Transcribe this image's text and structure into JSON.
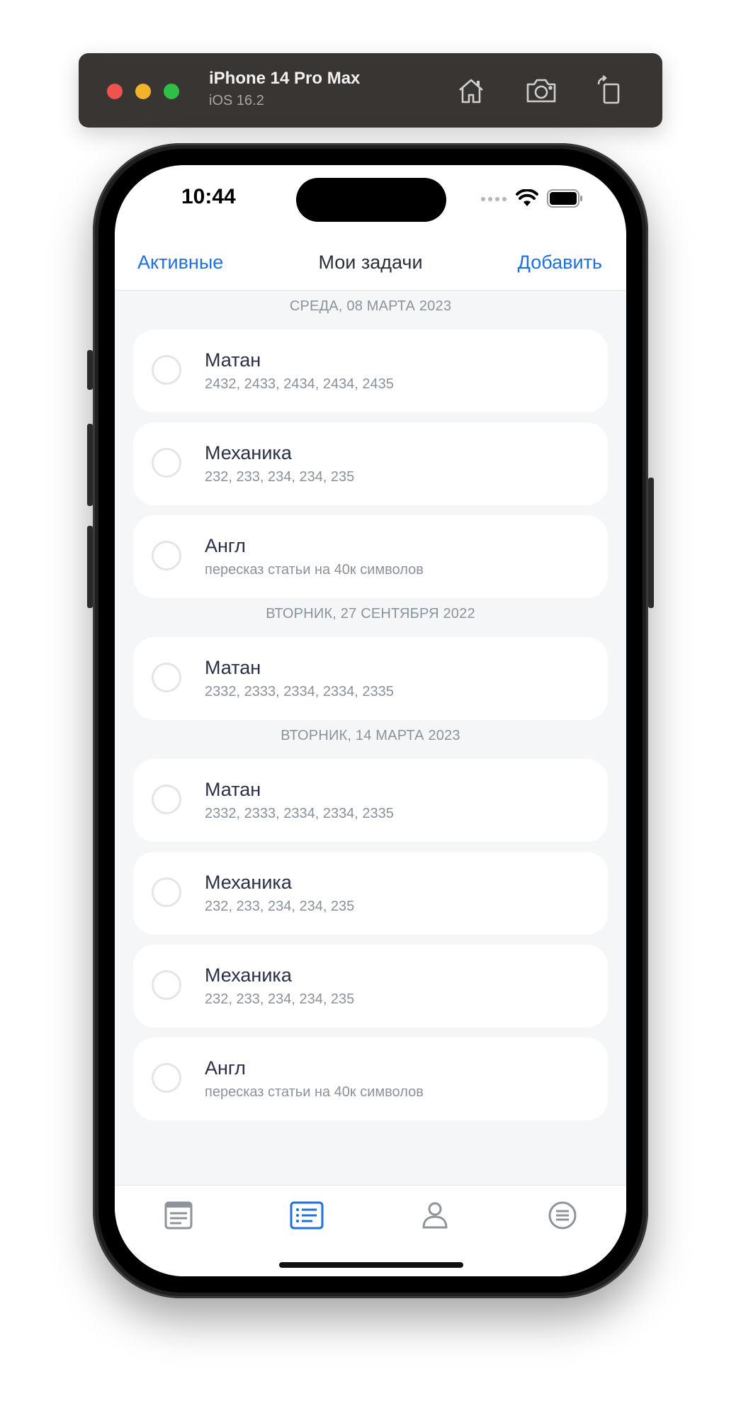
{
  "simulator": {
    "device_name": "iPhone 14 Pro Max",
    "os_version": "iOS 16.2",
    "toolbar_icons": [
      "home-icon",
      "screenshot-icon",
      "rotate-icon"
    ]
  },
  "status_bar": {
    "time": "10:44"
  },
  "nav": {
    "left_label": "Активные",
    "title": "Мои задачи",
    "right_label": "Добавить"
  },
  "sections": [
    {
      "header": "СРЕДА, 08 МАРТА 2023",
      "tasks": [
        {
          "title": "Матан",
          "subtitle": "2432, 2433, 2434, 2434, 2435"
        },
        {
          "title": "Механика",
          "subtitle": "232, 233, 234, 234, 235"
        },
        {
          "title": "Англ",
          "subtitle": "пересказ статьи на 40к символов"
        }
      ]
    },
    {
      "header": "ВТОРНИК, 27 СЕНТЯБРЯ 2022",
      "tasks": [
        {
          "title": "Матан",
          "subtitle": "2332, 2333, 2334, 2334, 2335"
        }
      ]
    },
    {
      "header": "ВТОРНИК, 14 МАРТА 2023",
      "tasks": [
        {
          "title": "Матан",
          "subtitle": "2332, 2333, 2334, 2334, 2335"
        },
        {
          "title": "Механика",
          "subtitle": "232, 233, 234, 234, 235"
        },
        {
          "title": "Механика",
          "subtitle": "232, 233, 234, 234, 235"
        },
        {
          "title": "Англ",
          "subtitle": "пересказ статьи на 40к символов"
        }
      ]
    }
  ],
  "tab_bar": {
    "items": [
      {
        "icon": "news-icon",
        "active": false
      },
      {
        "icon": "task-list-icon",
        "active": true
      },
      {
        "icon": "profile-icon",
        "active": false
      },
      {
        "icon": "menu-circle-icon",
        "active": false
      }
    ],
    "active_color": "#1f6fe0",
    "inactive_color": "#8e949b"
  },
  "colors": {
    "accent": "#1f6fe0",
    "background": "#f4f6f7",
    "card": "#ffffff"
  }
}
